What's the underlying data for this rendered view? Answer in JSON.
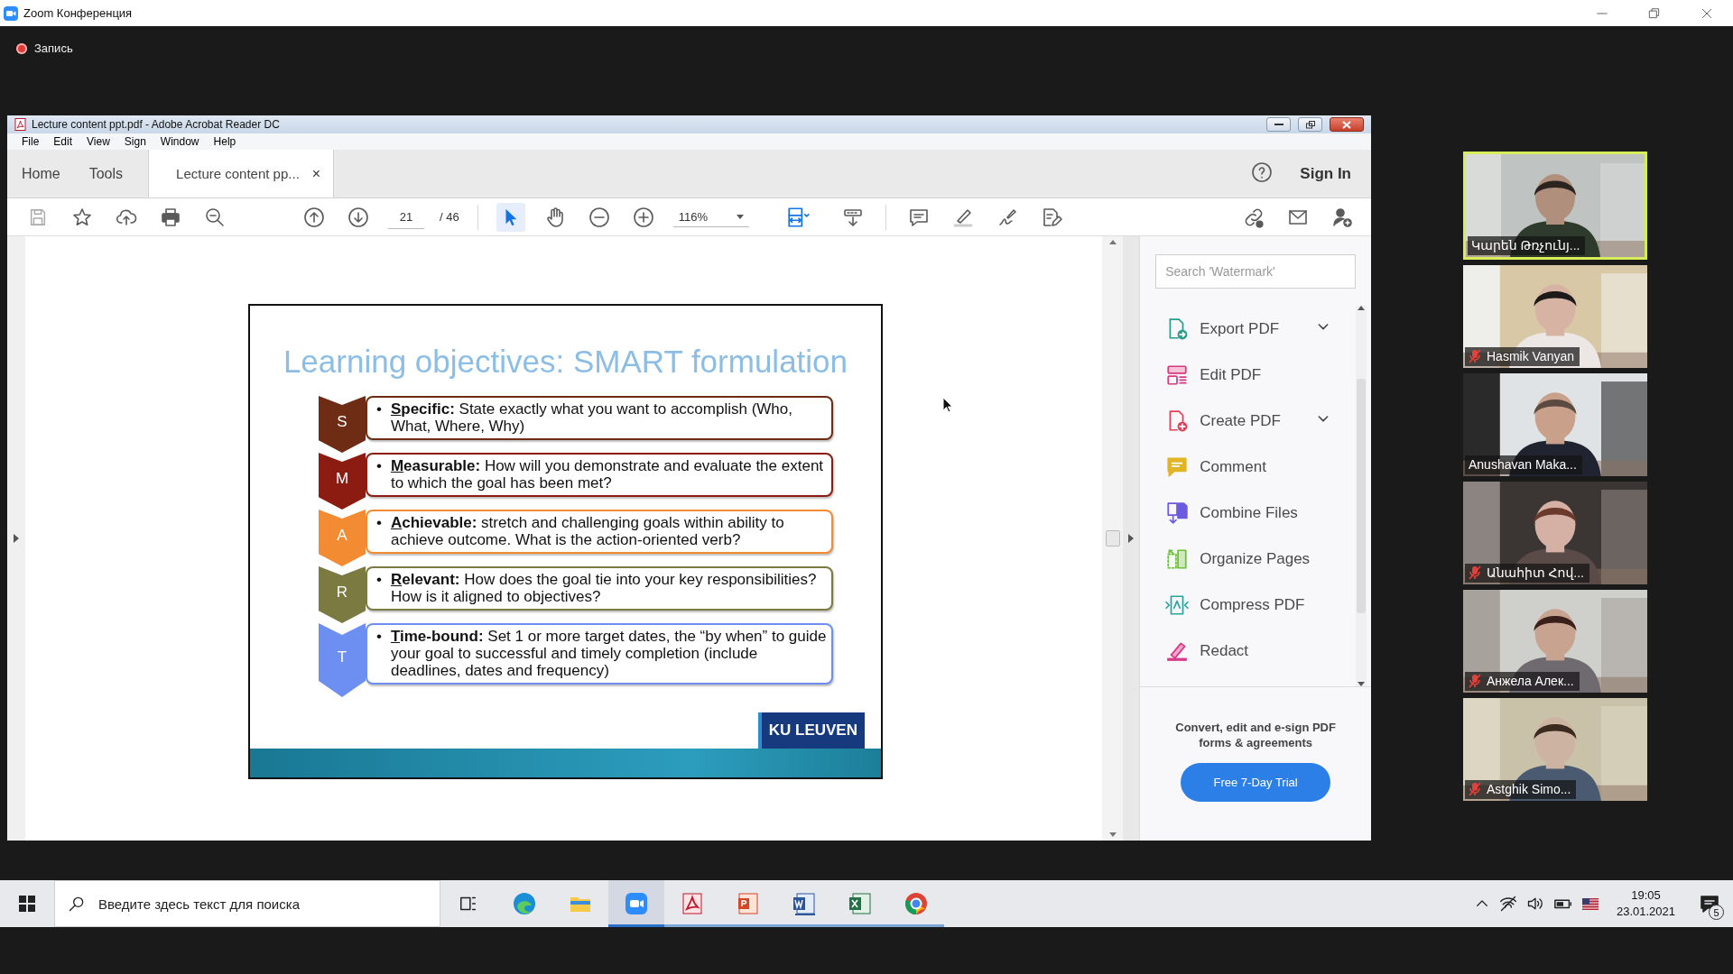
{
  "zoom_window": {
    "title": "Zoom Конференция"
  },
  "recording": {
    "label": "Запись",
    "on": true
  },
  "acrobat": {
    "title": "Lecture content ppt.pdf - Adobe Acrobat Reader DC",
    "menu": [
      "File",
      "Edit",
      "View",
      "Sign",
      "Window",
      "Help"
    ],
    "tabs": [
      {
        "label": "Home",
        "selected": false
      },
      {
        "label": "Tools",
        "selected": false
      },
      {
        "label": "Lecture content pp...",
        "selected": true,
        "close": "×"
      }
    ],
    "sign_in": "Sign In",
    "toolbar": {
      "page": "21",
      "page_total": "/ 46",
      "zoom": "116%",
      "select_tool": {
        "selected": true
      },
      "hand_tool": {
        "selected": false
      }
    },
    "slide": {
      "title": "Learning objectives: SMART formulation",
      "logo": "KU LEUVEN",
      "rows": [
        {
          "letter": "S",
          "color": "#6e2c14",
          "bullet": "•",
          "term": "Specific:",
          "text": "State exactly what you want to accomplish (Who, What, Where, Why)"
        },
        {
          "letter": "M",
          "color": "#8c1c12",
          "bullet": "•",
          "term": "Measurable:",
          "text": "How will you demonstrate and evaluate the extent to which the goal has been met?"
        },
        {
          "letter": "A",
          "color": "#f28b32",
          "bullet": "•",
          "term": "Achievable:",
          "text": "stretch and challenging goals within ability to achieve outcome. What is the action-oriented verb?"
        },
        {
          "letter": "R",
          "color": "#7b7a40",
          "bullet": "•",
          "term": "Relevant:",
          "text": "How does the goal tie into your key responsibilities? How is it aligned to objectives?"
        },
        {
          "letter": "T",
          "color": "#6e8ff2",
          "bullet": "•",
          "term": "Time-bound:",
          "text": "Set 1 or more target dates, the “by when” to guide your goal to successful and timely completion (include deadlines, dates and frequency)"
        }
      ]
    },
    "panel": {
      "search": {
        "placeholder": "Search 'Watermark'"
      },
      "tools": [
        {
          "label": "Export PDF",
          "kind": "export",
          "expandable": true
        },
        {
          "label": "Edit PDF",
          "kind": "edit",
          "expandable": false
        },
        {
          "label": "Create PDF",
          "kind": "create",
          "expandable": true
        },
        {
          "label": "Comment",
          "kind": "comment",
          "expandable": false
        },
        {
          "label": "Combine Files",
          "kind": "combine",
          "expandable": false
        },
        {
          "label": "Organize Pages",
          "kind": "organize",
          "expandable": false
        },
        {
          "label": "Compress PDF",
          "kind": "compress",
          "expandable": false
        },
        {
          "label": "Redact",
          "kind": "redact",
          "expandable": false
        }
      ],
      "promo": "Convert, edit and e-sign PDF forms & agreements",
      "button": "Free 7-Day Trial"
    }
  },
  "participants": [
    {
      "name": "Կարեն Թռչունյ...",
      "muted": false,
      "speaking": true
    },
    {
      "name": "Hasmik Vanyan",
      "muted": true,
      "speaking": false
    },
    {
      "name": "Anushavan Maka...",
      "muted": false,
      "speaking": false
    },
    {
      "name": "Անահիտ Հով...",
      "muted": true,
      "speaking": false
    },
    {
      "name": "Анжела Алек...",
      "muted": true,
      "speaking": false
    },
    {
      "name": "Astghik Simo...",
      "muted": true,
      "speaking": false
    }
  ],
  "taskbar": {
    "search": {
      "placeholder": "Введите здесь текст для поиска"
    },
    "apps": [
      {
        "kind": "edge",
        "running": false,
        "selected": false
      },
      {
        "kind": "explorer",
        "running": false,
        "selected": false
      },
      {
        "kind": "zoom",
        "running": true,
        "selected": true
      },
      {
        "kind": "acrobat",
        "running": true,
        "selected": false
      },
      {
        "kind": "powerpoint",
        "running": true,
        "selected": false
      },
      {
        "kind": "word",
        "running": true,
        "selected": false
      },
      {
        "kind": "excel",
        "running": true,
        "selected": false
      },
      {
        "kind": "chrome",
        "running": true,
        "selected": false
      }
    ],
    "time": "19:05",
    "date": "23.01.2021",
    "notifications": "5"
  }
}
